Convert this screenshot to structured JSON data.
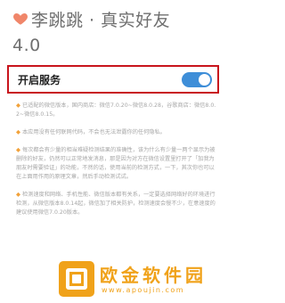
{
  "header": {
    "title": "李跳跳 · 真实好友",
    "version": "4.0"
  },
  "service": {
    "label": "开启服务",
    "enabled": true
  },
  "notes": [
    "已适配的微信版本，国内商店：微信7.0.20~微信8.0.28，谷歌商店：微信8.0.2~微信8.0.15。",
    "本应用没有任何联网代码，不会也无法泄露你的任何隐私。",
    "每次都会有少量的相当难疑检测结果的准确性，该为什么有少量一两个显示为被删除的好友，仍然可以正常地发消息，那是因为对方在微信设置里打开了「加我为朋友时需要验证」的功能，不然的话，使用当前的检测方式，一下，其次你也可以在上面用作用的原理文章，然后手动检测试试。",
    "检测速度和网络、手机性能、微信版本都有关系，一定要选择网络好的环境进行检测，从微信版本8.0.14起，微信加了相关防护，检测速度会慢不少，在意速度的建议使用微信7.0.20版本。"
  ],
  "watermark": {
    "text": "欧金软件园",
    "url": "www.apoujin.com"
  },
  "colors": {
    "accent": "#3e8ed8",
    "highlight_border": "#c8141c",
    "watermark": "#f0a21a",
    "heart": "#f0866a"
  },
  "icons": {
    "title": "heart-icon",
    "note_bullet": "flame-icon"
  }
}
